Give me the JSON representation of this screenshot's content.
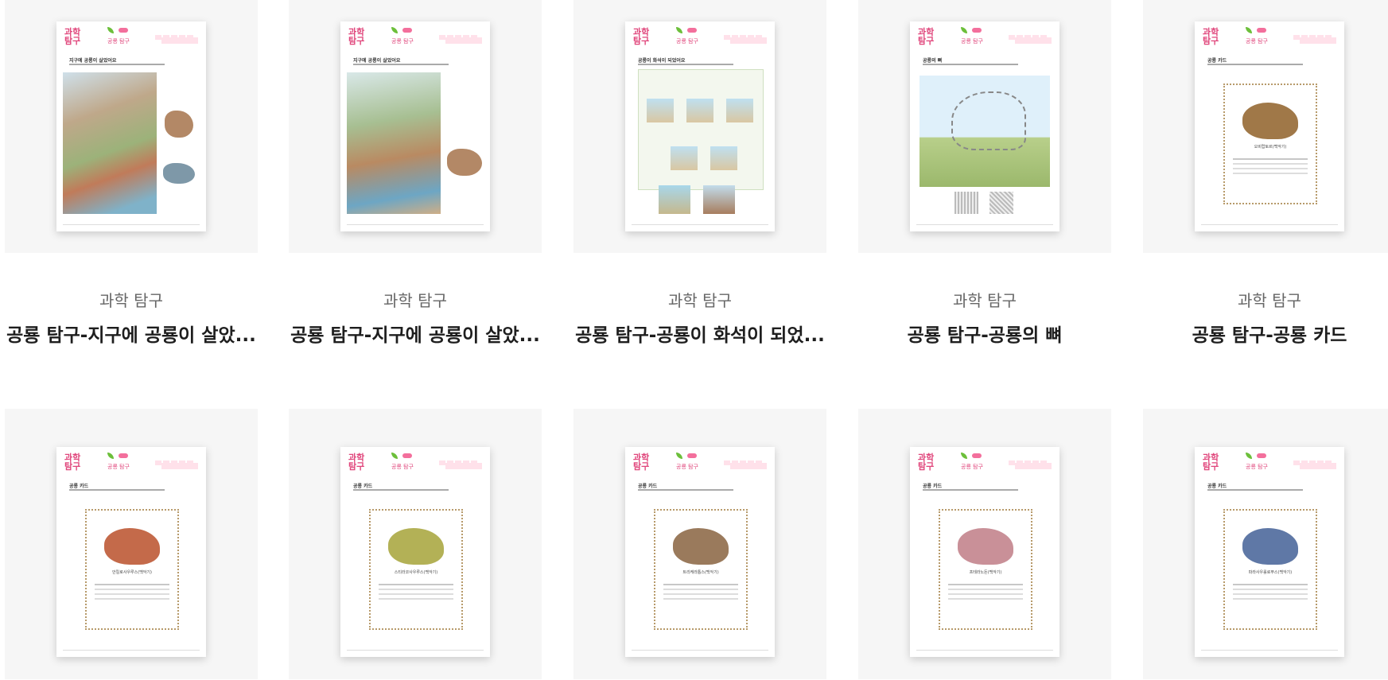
{
  "cards": [
    {
      "category": "과학 탐구",
      "title": "공룡 탐구-지구에 공룡이 살았...",
      "sheet": {
        "topic": "공룡 탐구",
        "heading": "지구에 공룡이 살았어요"
      }
    },
    {
      "category": "과학 탐구",
      "title": "공룡 탐구-지구에 공룡이 살았...",
      "sheet": {
        "topic": "공룡 탐구",
        "heading": "지구에 공룡이 살았어요"
      }
    },
    {
      "category": "과학 탐구",
      "title": "공룡 탐구-공룡이 화석이 되었...",
      "sheet": {
        "topic": "공룡 탐구",
        "heading": "공룡이 화석이 되었어요"
      }
    },
    {
      "category": "과학 탐구",
      "title": "공룡 탐구-공룡의 뼈",
      "sheet": {
        "topic": "공룡 탐구",
        "heading": "공룡의 뼈"
      }
    },
    {
      "category": "과학 탐구",
      "title": "공룡 탐구-공룡 카드",
      "sheet": {
        "topic": "공룡 탐구",
        "heading": "공룡 카드",
        "name": "오비랍토르(백악기)"
      }
    },
    {
      "sheet": {
        "topic": "공룡 탐구",
        "heading": "공룡 카드",
        "name": "안킬로사우루스(백악기)"
      }
    },
    {
      "sheet": {
        "topic": "공룡 탐구",
        "heading": "공룡 카드",
        "name": "스티라코사우루스(백악기)"
      }
    },
    {
      "sheet": {
        "topic": "공룡 탐구",
        "heading": "공룡 카드",
        "name": "트리케라톱스(백악기)"
      }
    },
    {
      "sheet": {
        "topic": "공룡 탐구",
        "heading": "공룡 카드",
        "name": "프테라노돈(백악기)"
      }
    },
    {
      "sheet": {
        "topic": "공룡 탐구",
        "heading": "공룡 카드",
        "name": "파라사우롤로푸스(백악기)"
      }
    }
  ],
  "logo_text": [
    "과학",
    "탐구"
  ],
  "colors": {
    "accent_pink": "#e0457b",
    "tile_bg": "#f6f6f6"
  }
}
